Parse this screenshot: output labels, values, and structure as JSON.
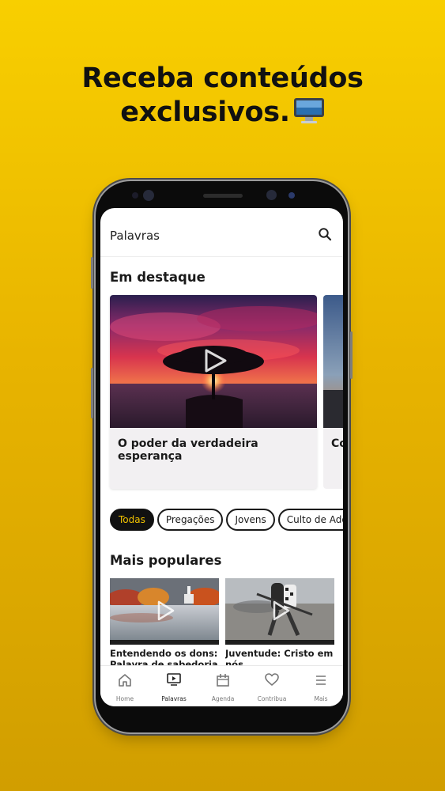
{
  "headline": {
    "line1": "Receba conteúdos",
    "line2": "exclusivos."
  },
  "app": {
    "title": "Palavras",
    "search_icon": "search-icon"
  },
  "featured": {
    "heading": "Em destaque",
    "cards": [
      {
        "title": "O poder da verdadeira esperança"
      },
      {
        "title": "Co"
      }
    ]
  },
  "filters": {
    "chips": [
      "Todas",
      "Pregações",
      "Jovens",
      "Culto de Ador"
    ],
    "selected": "Todas"
  },
  "popular": {
    "heading": "Mais populares",
    "items": [
      {
        "title": "Entendendo os dons: Palavra de sabedoria"
      },
      {
        "title": "Juventude: Cristo em nós"
      }
    ]
  },
  "nav": {
    "items": [
      {
        "label": "Home",
        "icon": "home-icon"
      },
      {
        "label": "Palavras",
        "icon": "video-play-icon"
      },
      {
        "label": "Agenda",
        "icon": "calendar-icon"
      },
      {
        "label": "Contribua",
        "icon": "heart-icon"
      },
      {
        "label": "Mais",
        "icon": "menu-icon"
      }
    ],
    "active": "Palavras"
  },
  "colors": {
    "background_top": "#F8CF00",
    "background_bottom": "#D19E00",
    "chip_active_text": "#F2C300"
  }
}
